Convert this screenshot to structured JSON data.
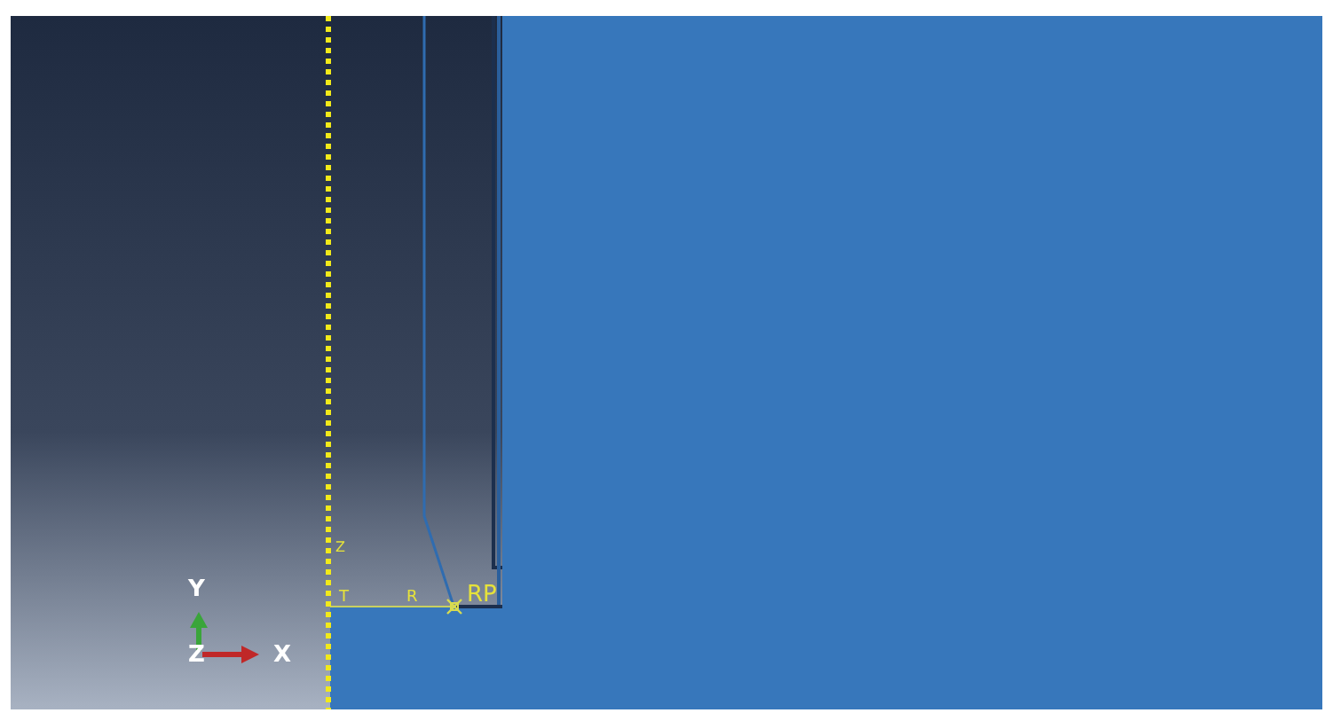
{
  "viewport": {
    "model_labels": [
      {
        "text": "Z"
      },
      {
        "text": "T"
      },
      {
        "text": "R"
      },
      {
        "text": "RP"
      }
    ],
    "triad": {
      "y_label": "Y",
      "z_label": "Z",
      "x_label": "X"
    }
  }
}
